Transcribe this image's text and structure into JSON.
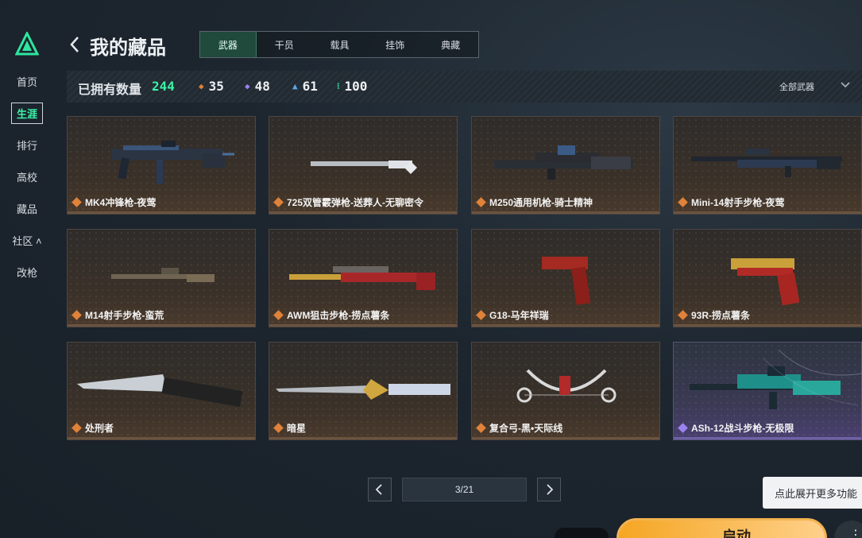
{
  "sidebar": {
    "items": [
      {
        "label": "首页"
      },
      {
        "label": "生涯"
      },
      {
        "label": "排行"
      },
      {
        "label": "高校"
      },
      {
        "label": "藏品"
      },
      {
        "label": "社区 ˄"
      },
      {
        "label": "改枪"
      }
    ],
    "active": "生涯"
  },
  "header": {
    "title": "我的藏品",
    "tabs": [
      {
        "label": "武器"
      },
      {
        "label": "干员"
      },
      {
        "label": "载具"
      },
      {
        "label": "挂饰"
      },
      {
        "label": "典藏"
      }
    ]
  },
  "stats": {
    "owned_label": "已拥有数量",
    "owned_count": "244",
    "orange": "35",
    "purple": "48",
    "blue": "61",
    "green": "100",
    "filter_label": "全部武器"
  },
  "cards": [
    {
      "name": "MK4冲锋枪-夜莺",
      "rarity": "orange"
    },
    {
      "name": "725双管霰弹枪-送葬人-无聊密令",
      "rarity": "orange"
    },
    {
      "name": "M250通用机枪-骑士精神",
      "rarity": "orange"
    },
    {
      "name": "Mini-14射手步枪-夜莺",
      "rarity": "orange"
    },
    {
      "name": "M14射手步枪-蛮荒",
      "rarity": "orange"
    },
    {
      "name": "AWM狙击步枪-捞点薯条",
      "rarity": "orange"
    },
    {
      "name": "G18-马年祥瑞",
      "rarity": "orange"
    },
    {
      "name": "93R-捞点薯条",
      "rarity": "orange"
    },
    {
      "name": "处刑者",
      "rarity": "orange"
    },
    {
      "name": "暗星",
      "rarity": "orange"
    },
    {
      "name": "复合弓-黑•天际线",
      "rarity": "orange"
    },
    {
      "name": "ASh-12战斗步枪-无极限",
      "rarity": "purple"
    }
  ],
  "pagination": {
    "label": "3/21"
  },
  "tooltip": {
    "text": "点此展开更多功能"
  },
  "bottom": {
    "start_label": "启动"
  },
  "colors": {
    "accent": "#3cf2a7",
    "orange": "#e0823a",
    "purple": "#9b82f0",
    "blue": "#5fa6e8",
    "green": "#3cf2a7"
  }
}
